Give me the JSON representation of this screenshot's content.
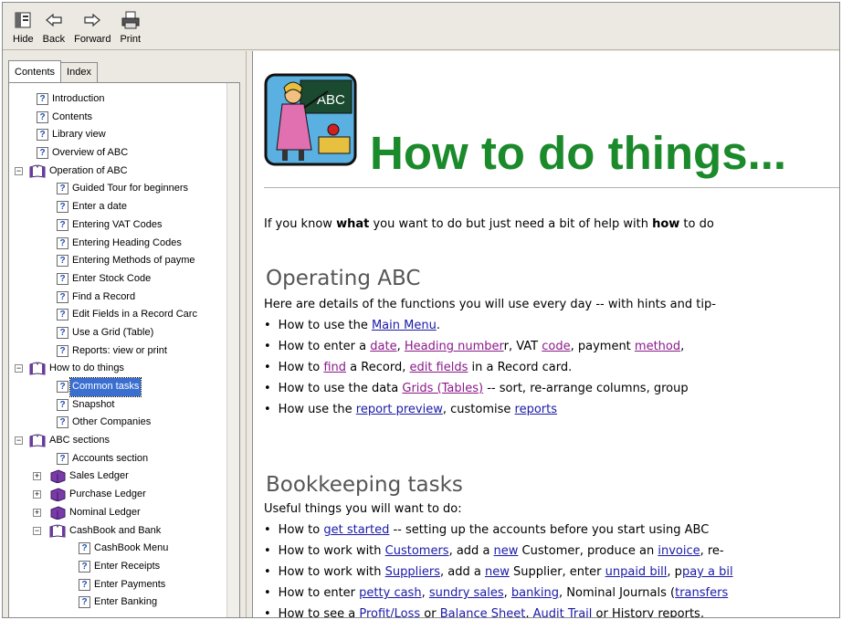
{
  "toolbar": {
    "hide": "Hide",
    "back": "Back",
    "forward": "Forward",
    "print": "Print"
  },
  "tabs": {
    "contents": "Contents",
    "index": "Index"
  },
  "tree": [
    {
      "label": "Introduction",
      "icon": "topic",
      "level": 1
    },
    {
      "label": "Contents",
      "icon": "topic",
      "level": 1
    },
    {
      "label": "Library view",
      "icon": "topic",
      "level": 1
    },
    {
      "label": "Overview of ABC",
      "icon": "topic",
      "level": 1
    },
    {
      "label": "Operation of ABC",
      "icon": "book-open",
      "level": 0,
      "expander": "-"
    },
    {
      "label": "Guided Tour for beginners",
      "icon": "topic",
      "level": 2
    },
    {
      "label": "Enter a date",
      "icon": "topic",
      "level": 2
    },
    {
      "label": "Entering VAT Codes",
      "icon": "topic",
      "level": 2
    },
    {
      "label": "Entering Heading Codes",
      "icon": "topic",
      "level": 2
    },
    {
      "label": "Entering Methods of payme",
      "icon": "topic",
      "level": 2
    },
    {
      "label": "Enter Stock Code",
      "icon": "topic",
      "level": 2
    },
    {
      "label": "Find a Record",
      "icon": "topic",
      "level": 2
    },
    {
      "label": "Edit Fields in a Record Carc",
      "icon": "topic",
      "level": 2
    },
    {
      "label": "Use a Grid (Table)",
      "icon": "topic",
      "level": 2
    },
    {
      "label": "Reports: view or print",
      "icon": "topic",
      "level": 2
    },
    {
      "label": "How to do things",
      "icon": "book-open",
      "level": 0,
      "expander": "-"
    },
    {
      "label": "Common tasks",
      "icon": "topic",
      "level": 2,
      "selected": true
    },
    {
      "label": "Snapshot",
      "icon": "topic",
      "level": 2
    },
    {
      "label": "Other Companies",
      "icon": "topic",
      "level": 2
    },
    {
      "label": "ABC sections",
      "icon": "book-open",
      "level": 0,
      "expander": "-"
    },
    {
      "label": "Accounts section",
      "icon": "topic",
      "level": 2
    },
    {
      "label": "Sales Ledger",
      "icon": "book-closed",
      "level": 1,
      "expander": "+"
    },
    {
      "label": "Purchase Ledger",
      "icon": "book-closed",
      "level": 1,
      "expander": "+"
    },
    {
      "label": "Nominal Ledger",
      "icon": "book-closed",
      "level": 1,
      "expander": "+"
    },
    {
      "label": "CashBook and Bank",
      "icon": "book-open",
      "level": 1,
      "expander": "-"
    },
    {
      "label": "CashBook Menu",
      "icon": "topic",
      "level": 3
    },
    {
      "label": "Enter Receipts",
      "icon": "topic",
      "level": 3
    },
    {
      "label": "Enter Payments",
      "icon": "topic",
      "level": 3
    },
    {
      "label": "Enter Banking",
      "icon": "topic",
      "level": 3
    }
  ],
  "content": {
    "title": "How to do things...",
    "intro_a": "If you know ",
    "intro_b": "what",
    "intro_c": " you want to do but just need a bit of help with ",
    "intro_d": "how",
    "intro_e": " to do",
    "section1": {
      "heading": "Operating ABC",
      "desc": "Here are details of the functions you will use every day -- with hints and tip-"
    },
    "section2": {
      "heading": "Bookkeeping tasks",
      "desc": "Useful things you will want to do:"
    },
    "links": {
      "main_menu": "Main Menu",
      "date": "date",
      "heading_number": "Heading number",
      "code": "code",
      "method": "method",
      "find": "find",
      "edit_fields": "edit fields",
      "grids": "Grids (Tables)",
      "report_preview": "report preview",
      "reports": "reports",
      "get_started": "get started",
      "customers": "Customers",
      "new1": "new",
      "invoice": "invoice",
      "suppliers": "Suppliers",
      "new2": "new",
      "unpaid_bill": "unpaid bill",
      "pay_a_bill": "pay a bil",
      "petty_cash": "petty cash",
      "sundry_sales": "sundry sales",
      "banking": "banking",
      "transfers": "transfers",
      "profit_loss": "Profit/Loss",
      "balance_sheet": "Balance Sheet",
      "audit_trail": "Audit Trail"
    },
    "text": {
      "b1_pre": "How to use the ",
      "b1_post": ".",
      "b2_pre": "How to enter a ",
      "b2_c1": ", ",
      "b2_c2": "r, VAT ",
      "b2_c3": ", payment ",
      "b2_c4": ",",
      "b3_pre": "How to ",
      "b3_mid": " a Record, ",
      "b3_post": " in a Record card.",
      "b4_pre": "How to use the data ",
      "b4_post": " -- sort, re-arrange columns, group",
      "b5_pre": "How use the ",
      "b5_mid": ", customise ",
      "c1_pre": "How to ",
      "c1_post": " -- setting up the accounts before you start using ABC",
      "c2_pre": "How to work with ",
      "c2_a": ", add a ",
      "c2_b": " Customer, produce an ",
      "c2_c": ", re-",
      "c3_pre": "How to work with ",
      "c3_a": ", add a ",
      "c3_b": " Supplier, enter ",
      "c3_c": ", p",
      "c4_pre": "How to enter ",
      "c4_a": ", ",
      "c4_b": ", ",
      "c4_c": ", Nominal Journals (",
      "c5_pre": "How to see a ",
      "c5_a": " or ",
      "c5_b": ", ",
      "c5_c": " or History reports, "
    }
  }
}
